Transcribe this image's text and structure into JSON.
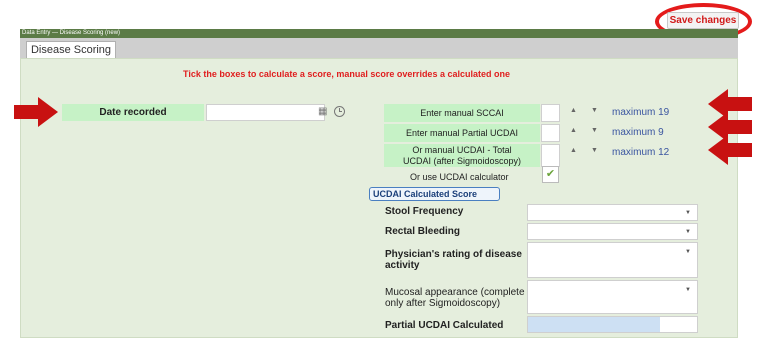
{
  "toolbar": {
    "save_label": "Save changes"
  },
  "window": {
    "title": "Data Entry — Disease Scoring (new)"
  },
  "tabs": [
    {
      "label": "Disease Scoring"
    }
  ],
  "instructions": "Tick the boxes to calculate a score, manual score overrides a calculated one",
  "date": {
    "label": "Date recorded",
    "value": ""
  },
  "manual": [
    {
      "label": "Enter manual SCCAI",
      "max": "maximum 19"
    },
    {
      "label": "Enter manual Partial UCDAI",
      "max": "maximum 9"
    },
    {
      "label": "Or manual UCDAI - Total UCDAI (after Sigmoidoscopy)",
      "max": "maximum 12"
    }
  ],
  "calculator": {
    "label": "Or use UCDAI calculator",
    "checked": true
  },
  "ucdai": {
    "title": "UCDAI Calculated Score",
    "fields": [
      {
        "label": "Stool Frequency"
      },
      {
        "label": "Rectal Bleeding"
      },
      {
        "label": "Physician's rating of disease activity"
      },
      {
        "label": "Mucosal appearance (complete only after Sigmoidoscopy)"
      }
    ],
    "partial_label": "Partial UCDAI Calculated",
    "partial_fill": 0.78
  },
  "colors": {
    "accent_red": "#e01f1f",
    "label_green": "#c6f2c6",
    "panel_bg": "#e5eedd",
    "titlebar": "#5b7b46"
  }
}
